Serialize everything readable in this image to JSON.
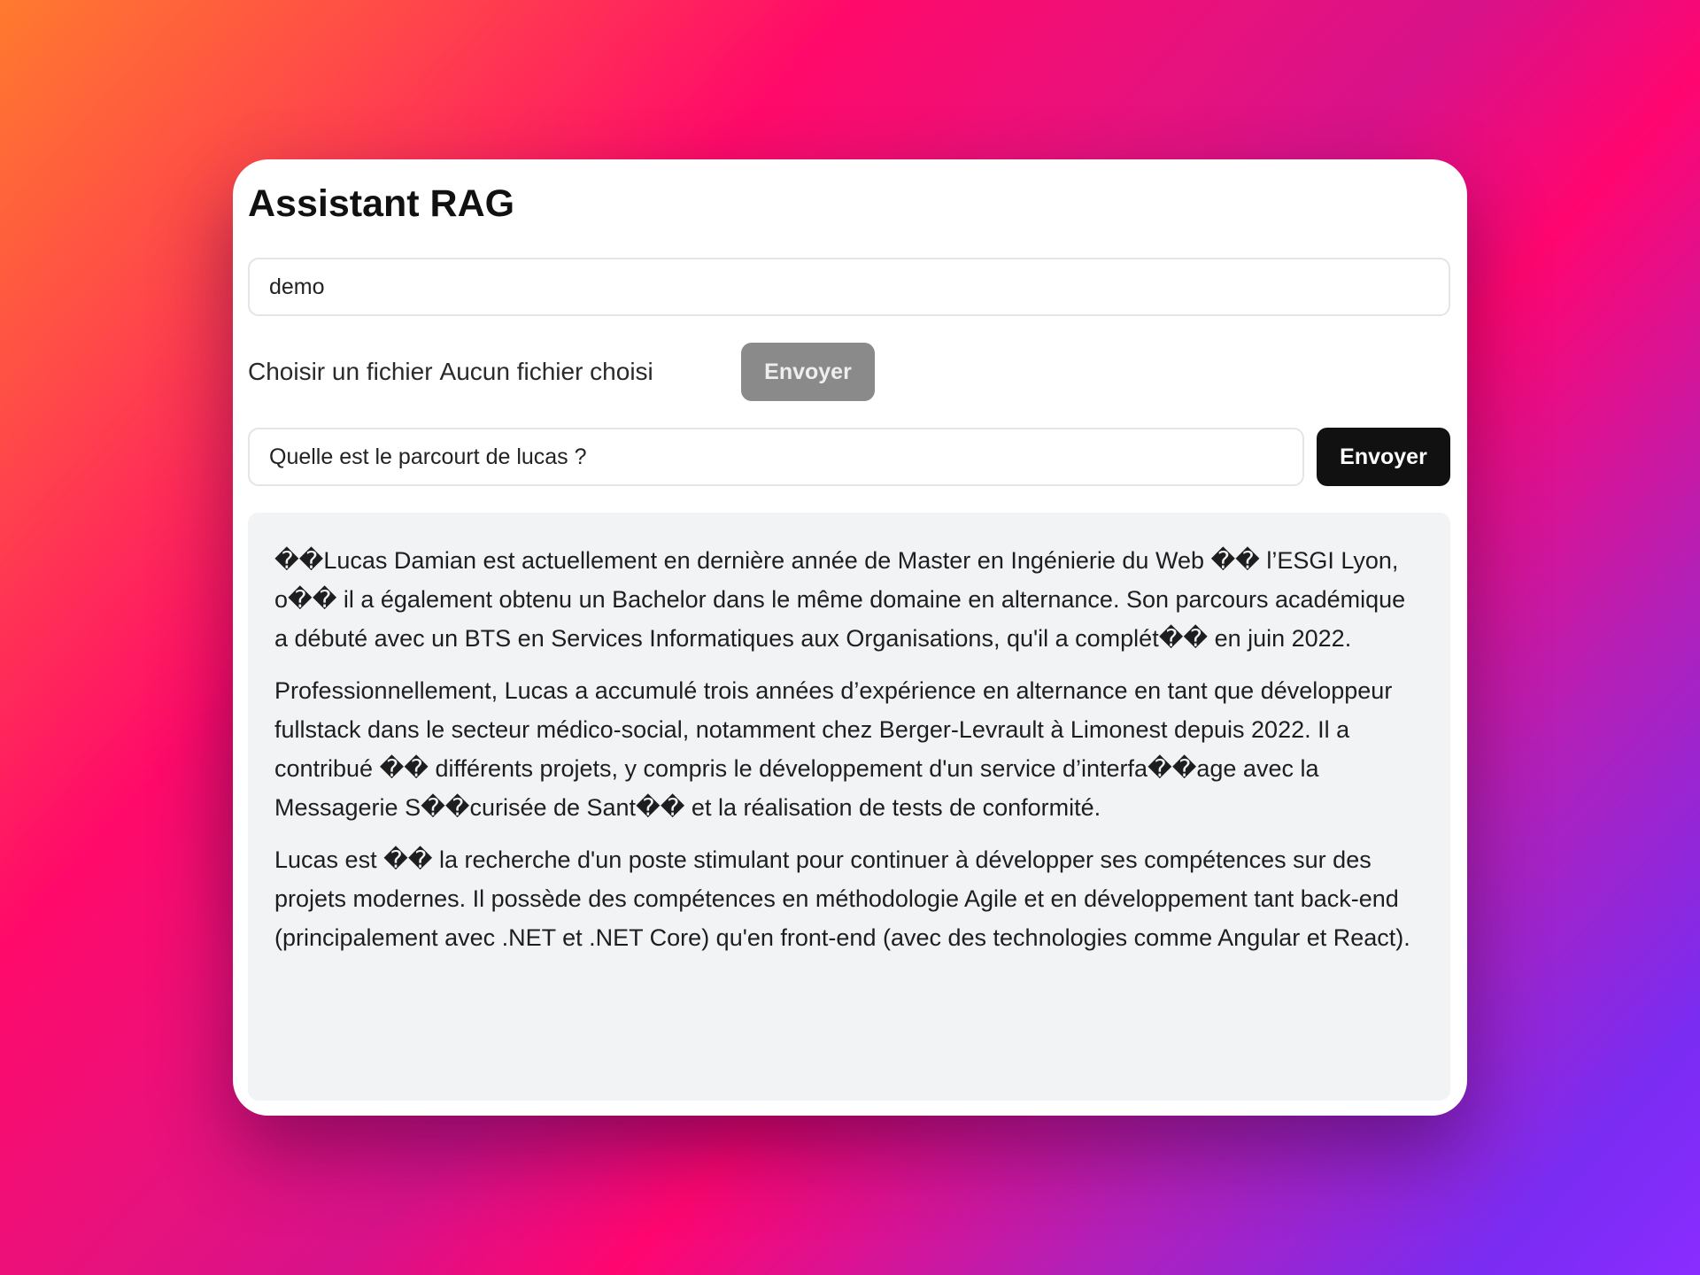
{
  "app": {
    "title": "Assistant RAG"
  },
  "collection_input": {
    "value": "demo"
  },
  "upload": {
    "choose_label": "Choisir un fichier",
    "status": "Aucun fichier choisi",
    "button_label": "Envoyer"
  },
  "question": {
    "value": "Quelle est le parcourt de lucas ?",
    "button_label": "Envoyer"
  },
  "answer": {
    "paragraphs": [
      "��Lucas Damian est actuellement en dernière année de Master en Ingénierie du Web �� l’ESGI Lyon, o�� il a également obtenu un Bachelor dans le même domaine en alternance. Son parcours académique a débuté avec un BTS en Services Informatiques aux Organisations, qu'il a complét�� en juin 2022.",
      "Professionnellement, Lucas a accumulé trois années d’expérience en alternance en tant que développeur fullstack dans le secteur médico-social, notamment chez Berger-Levrault à Limonest depuis 2022. Il a contribué �� différents projets, y compris le développement d'un service d’interfa��age avec la Messagerie S��curisée de Sant�� et la réalisation de tests de conformité.",
      "Lucas est �� la recherche d'un poste stimulant pour continuer à développer ses compétences sur des projets modernes. Il possède des compétences en méthodologie Agile et en développement tant back-end (principalement avec .NET et .NET Core) qu'en front-end (avec des technologies comme Angular et React)."
    ]
  }
}
